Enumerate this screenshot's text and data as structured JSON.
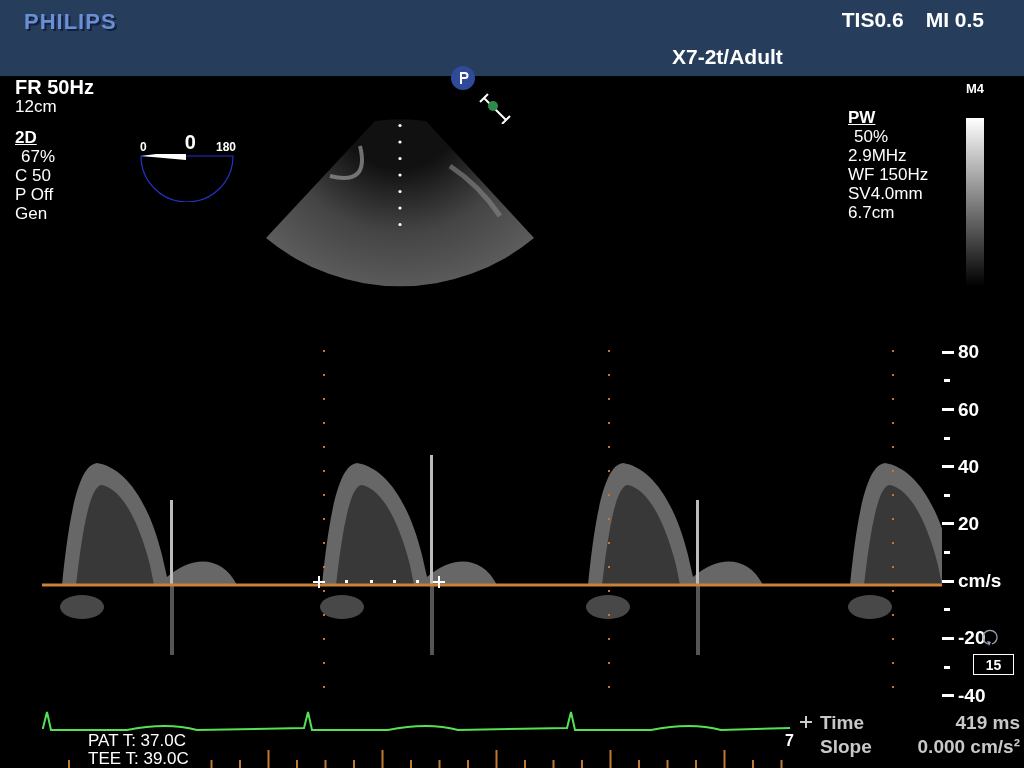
{
  "header": {
    "brand": "PHILIPS",
    "indices": [
      "TIS0.6",
      "MI 0.5"
    ],
    "transducer": "X7-2t/Adult"
  },
  "left_panel": [
    {
      "kind": "title",
      "text": "FR 50Hz"
    },
    {
      "kind": "value",
      "text": "12cm"
    },
    {
      "kind": "header",
      "text": "2D"
    },
    {
      "kind": "indented",
      "text": "67%"
    },
    {
      "kind": "value",
      "text": "C 50"
    },
    {
      "kind": "value",
      "text": "P Off"
    },
    {
      "kind": "value",
      "text": "Gen"
    }
  ],
  "angle_dial": {
    "min": "0",
    "value": "0",
    "max": "180"
  },
  "right_panel": {
    "map": "M4",
    "lines": [
      {
        "kind": "header",
        "text": "PW"
      },
      {
        "kind": "indented",
        "text": "50%"
      },
      {
        "kind": "value",
        "text": "2.9MHz"
      },
      {
        "kind": "value",
        "text": "WF 150Hz"
      },
      {
        "kind": "value",
        "text": "SV4.0mm"
      },
      {
        "kind": "value",
        "text": "6.7cm"
      }
    ]
  },
  "velocity_scale": {
    "labels": [
      "80",
      "60",
      "40",
      "20",
      "cm/s",
      "-20",
      "-40"
    ],
    "sweep_speed": "15"
  },
  "bottom": {
    "temperatures": [
      "PAT T: 37.0C",
      "TEE T: 39.0C"
    ],
    "ecg_marker": "7",
    "measurements": [
      {
        "label": "Time",
        "value": "419 ms"
      },
      {
        "label": "Slope",
        "value": "0.000 cm/s²"
      }
    ]
  }
}
